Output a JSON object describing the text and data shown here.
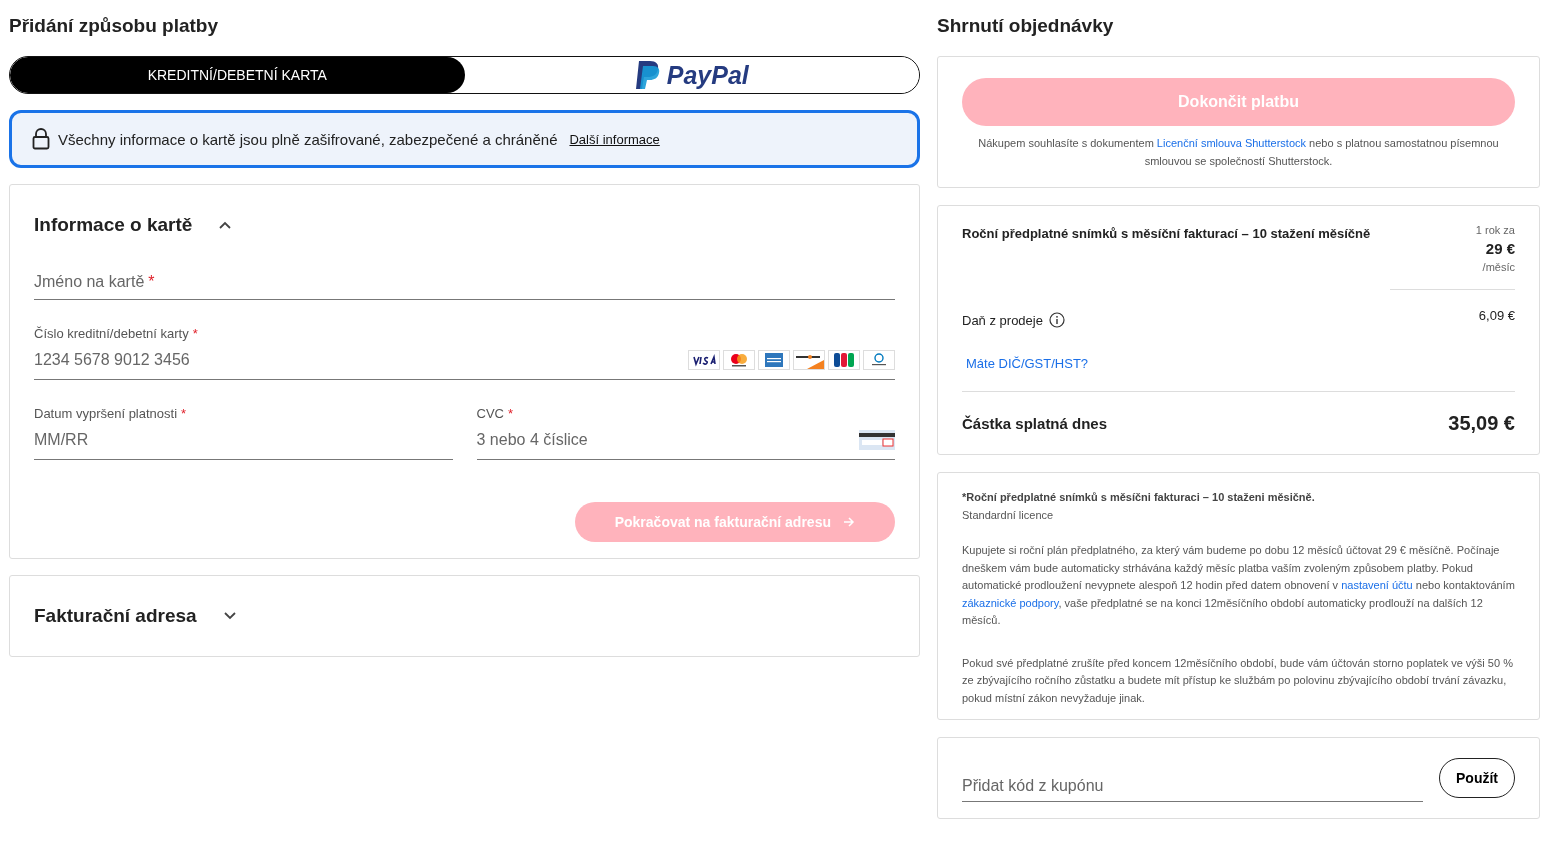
{
  "left": {
    "title": "Přidání způsobu platby",
    "tabs": [
      {
        "label": "KREDITNÍ/DEBETNÍ KARTA",
        "kind": "text",
        "selected": true
      },
      {
        "label": "PayPal",
        "kind": "paypal",
        "selected": false
      }
    ],
    "notice": {
      "text": "Všechny informace o kartě jsou plně zašifrované, zabezpečené a chráněné",
      "link": "Další informace"
    },
    "card_section": {
      "title": "Informace o kartě",
      "expanded": true,
      "name_field": {
        "placeholder": "Jméno na kartě",
        "required_mark": "*"
      },
      "number_field": {
        "label": "Číslo kreditní/debetní karty",
        "required_mark": "*",
        "placeholder": "1234 5678 9012 3456"
      },
      "expiry_field": {
        "label": "Datum vypršení platnosti",
        "required_mark": "*",
        "placeholder": "MM/RR"
      },
      "cvc_field": {
        "label": "CVC",
        "required_mark": "*",
        "placeholder": "3 nebo 4 číslice"
      },
      "continue_button": {
        "label": "Pokračovat na fakturační adresu",
        "disabled": true
      }
    },
    "billing_section": {
      "title": "Fakturační adresa",
      "expanded": false
    }
  },
  "right": {
    "title": "Shrnutí objednávky",
    "pay_button": {
      "label": "Dokončit platbu",
      "disabled": true
    },
    "agreement": [
      {
        "kind": "text",
        "text": "Nákupem souhlasíte s dokumentem "
      },
      {
        "kind": "link",
        "text": "Licenční smlouva Shutterstock"
      },
      {
        "kind": "text",
        "text": " nebo s platnou samostatnou písemnou smlouvou se společností Shutterstock."
      }
    ],
    "item": {
      "name": "Roční předplatné snímků s měsíční fakturací – 10 stažení měsíčně",
      "price_prefix": "1 rok za",
      "price": "29 €",
      "price_suffix": "/měsíc"
    },
    "tax": {
      "label": "Daň z prodeje",
      "value": "6,09 €"
    },
    "vat_link": "Máte DIČ/GST/HST?",
    "total": {
      "label": "Částka splatná dnes",
      "value": "35,09 €"
    },
    "terms": {
      "heading": "*Roční předplatné snímků s měsíčni fakturaci – 10 staženi měsičně.",
      "subheading": "Standardní licence",
      "paragraphs": [
        [
          {
            "kind": "text",
            "text": "Kupujete si roční plán předplatného, za který vám budeme po dobu 12 měsíců účtovat 29 € měsíčně. Počínaje dneškem vám bude automaticky strhávána každý měsíc platba vaším zvoleným způsobem platby. Pokud automatické prodloužení nevypnete alespoň 12 hodin před datem obnovení v "
          },
          {
            "kind": "link",
            "text": "nastavení účtu"
          },
          {
            "kind": "text",
            "text": " nebo kontaktováním "
          },
          {
            "kind": "link",
            "text": "zákaznické podpory"
          },
          {
            "kind": "text",
            "text": ", vaše předplatné se na konci 12měsíčního období automaticky prodlouží na dalších 12 měsíců."
          }
        ],
        [
          {
            "kind": "text",
            "text": "Pokud své předplatné zrušíte před koncem 12měsíčního období, bude vám účtován storno poplatek ve výši 50 % ze zbývajícího ročního zůstatku a budete mít přístup ke službám po polovinu zbývajícího období trvání závazku, pokud místní zákon nevyžaduje jinak."
          }
        ]
      ]
    },
    "coupon": {
      "placeholder": "Přidat kód z kupónu",
      "button": "Použít"
    }
  }
}
